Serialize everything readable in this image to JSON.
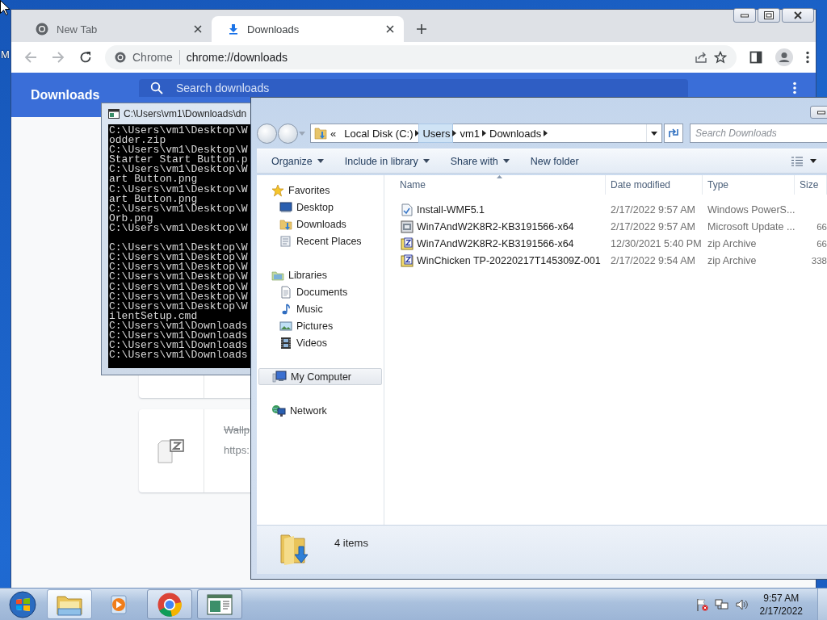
{
  "desktop": {
    "icon_label": "M"
  },
  "browser": {
    "tabs": [
      {
        "title": "New Tab",
        "kind": "newtab",
        "selected": false
      },
      {
        "title": "Downloads",
        "kind": "downloads",
        "selected": true
      }
    ],
    "toolbar": {
      "back_disabled": true,
      "forward_disabled": true
    },
    "omnibox": {
      "site_label": "Chrome",
      "url": "chrome://downloads"
    },
    "page": {
      "title": "Downloads",
      "search": {
        "placeholder": "Search downloads"
      },
      "items": [
        {
          "name": "Wallp",
          "url": "https:",
          "removed": true
        }
      ]
    }
  },
  "console": {
    "title": "C:\\Users\\vm1\\Downloads\\dn",
    "blocks": [
      [
        "C:\\Users\\vm1\\Desktop\\W",
        "odder.zip",
        "C:\\Users\\vm1\\Desktop\\W",
        "Starter Start Button.p",
        "C:\\Users\\vm1\\Desktop\\W",
        "art Button.png",
        "C:\\Users\\vm1\\Desktop\\W",
        "art Button.png",
        "C:\\Users\\vm1\\Desktop\\W",
        "Orb.png",
        "C:\\Users\\vm1\\Desktop\\W"
      ],
      [
        "C:\\Users\\vm1\\Desktop\\W",
        "C:\\Users\\vm1\\Desktop\\W",
        "C:\\Users\\vm1\\Desktop\\W",
        "C:\\Users\\vm1\\Desktop\\W",
        "C:\\Users\\vm1\\Desktop\\W",
        "C:\\Users\\vm1\\Desktop\\W",
        "C:\\Users\\vm1\\Desktop\\W",
        "ilentSetup.cmd",
        "C:\\Users\\vm1\\Downloads",
        "C:\\Users\\vm1\\Downloads",
        "C:\\Users\\vm1\\Downloads",
        "C:\\Users\\vm1\\Downloads"
      ]
    ]
  },
  "explorer": {
    "overflow_marker": "«",
    "breadcrumbs": [
      {
        "label": "Local Disk (C:)",
        "hovered": false
      },
      {
        "label": "Users",
        "hovered": true
      },
      {
        "label": "vm1",
        "hovered": false
      },
      {
        "label": "Downloads",
        "hovered": false
      }
    ],
    "search": {
      "placeholder": "Search Downloads"
    },
    "toolbar": [
      {
        "label": "Organize",
        "dropdown": true
      },
      {
        "label": "Include in library",
        "dropdown": true
      },
      {
        "label": "Share with",
        "dropdown": true
      },
      {
        "label": "New folder",
        "dropdown": false
      }
    ],
    "nav": [
      {
        "label": "Favorites",
        "kind": "star",
        "selected": false,
        "children": [
          {
            "label": "Desktop",
            "kind": "desktop",
            "selected": false
          },
          {
            "label": "Downloads",
            "kind": "downloads",
            "selected": false
          },
          {
            "label": "Recent Places",
            "kind": "recent",
            "selected": false
          }
        ]
      },
      {
        "label": "Libraries",
        "kind": "library",
        "selected": false,
        "children": [
          {
            "label": "Documents",
            "kind": "document",
            "selected": false
          },
          {
            "label": "Music",
            "kind": "music",
            "selected": false
          },
          {
            "label": "Pictures",
            "kind": "pictures",
            "selected": false
          },
          {
            "label": "Videos",
            "kind": "videos",
            "selected": false
          }
        ]
      },
      {
        "label": "My Computer",
        "kind": "computer",
        "selected": true
      },
      {
        "label": "Network",
        "kind": "network",
        "selected": false
      }
    ],
    "columns": [
      "Name",
      "Date modified",
      "Type",
      "Size"
    ],
    "files": [
      {
        "name": "Install-WMF5.1",
        "kind": "script",
        "date": "2/17/2022 9:57 AM",
        "type": "Windows PowerS..."
      },
      {
        "name": "Win7AndW2K8R2-KB3191566-x64",
        "kind": "installer",
        "date": "2/17/2022 9:57 AM",
        "type": "Microsoft Update ...",
        "size": "66"
      },
      {
        "name": "Win7AndW2K8R2-KB3191566-x64",
        "kind": "archive",
        "date": "12/30/2021 5:40 PM",
        "type": "zip Archive",
        "size": "66"
      },
      {
        "name": "WinChicken TP-20220217T145309Z-001",
        "kind": "archive",
        "date": "2/17/2022 9:54 AM",
        "type": "zip Archive",
        "size": "338"
      }
    ],
    "status": "4 items"
  },
  "taskbar": {
    "apps": [
      {
        "kind": "explorer",
        "running": true,
        "selected": true
      },
      {
        "kind": "media",
        "running": false,
        "selected": false
      },
      {
        "kind": "browser",
        "running": true,
        "selected": false
      },
      {
        "kind": "console",
        "running": true,
        "selected": false
      }
    ],
    "clock": {
      "time": "9:57 AM",
      "date": "2/17/2022"
    }
  }
}
